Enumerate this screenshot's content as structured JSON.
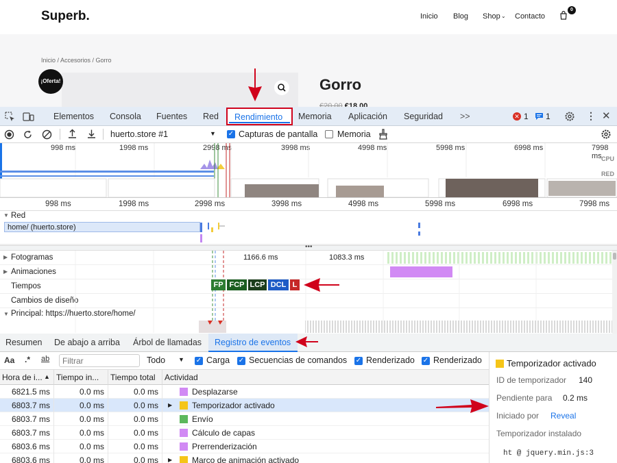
{
  "site": {
    "logo": "Superb.",
    "nav": [
      "Inicio",
      "Blog",
      "Shop",
      "Contacto"
    ],
    "cart_count": "0",
    "breadcrumb": "Inicio / Accesorios / Gorro",
    "sale_badge": "¡Oferta!",
    "product_title": "Gorro",
    "price_old": "€20.00",
    "price_new": "€18.00"
  },
  "devtools": {
    "tabs": [
      "Elementos",
      "Consola",
      "Fuentes",
      "Red",
      "Rendimiento",
      "Memoria",
      "Aplicación",
      "Seguridad"
    ],
    "active_tab": "Rendimiento",
    "more_tabs": ">>",
    "errors": "1",
    "messages": "1",
    "profile_select": "huerto.store #1",
    "chk_screenshots": "Capturas de pantalla",
    "chk_memory": "Memoria",
    "overview_labels": [
      "998 ms",
      "1998 ms",
      "2998 ms",
      "3998 ms",
      "4998 ms",
      "5998 ms",
      "6998 ms",
      "7998 ms"
    ],
    "overview_cpu": "CPU",
    "overview_net": "RED",
    "ruler_labels": [
      "998 ms",
      "1998 ms",
      "2998 ms",
      "3998 ms",
      "4998 ms",
      "5998 ms",
      "6998 ms",
      "7998 ms"
    ],
    "network_title": "Red",
    "network_request": "home/ (huerto.store)",
    "tracks": [
      "Fotogramas",
      "Animaciones",
      "Tiempos",
      "Cambios de diseño",
      "Principal: https://huerto.store/home/"
    ],
    "frame_times": [
      "1166.6 ms",
      "1083.3 ms"
    ],
    "timing_marks": [
      "FP",
      "FCP",
      "LCP",
      "DCL",
      "L"
    ],
    "bottom_tabs": [
      "Resumen",
      "De abajo a arriba",
      "Árbol de llamadas",
      "Registro de eventos"
    ],
    "active_bottom_tab": "Registro de eventos",
    "filter_placeholder": "Filtrar",
    "filter_select": "Todo",
    "filter_checks": [
      "Carga",
      "Secuencias de comandos",
      "Renderizado",
      "Renderizado"
    ],
    "columns": [
      "Hora de i...",
      "Tiempo in...",
      "Tiempo total",
      "Actividad"
    ],
    "rows": [
      {
        "start": "6821.5 ms",
        "self": "0.0 ms",
        "total": "0.0 ms",
        "activity": "Desplazarse",
        "color": "#d18af4",
        "expand": ""
      },
      {
        "start": "6803.7 ms",
        "self": "0.0 ms",
        "total": "0.0 ms",
        "activity": "Temporizador activado",
        "color": "#f5c518",
        "expand": "▶"
      },
      {
        "start": "6803.7 ms",
        "self": "0.0 ms",
        "total": "0.0 ms",
        "activity": "Envío",
        "color": "#5cb85c",
        "expand": ""
      },
      {
        "start": "6803.7 ms",
        "self": "0.0 ms",
        "total": "0.0 ms",
        "activity": "Cálculo de capas",
        "color": "#d18af4",
        "expand": ""
      },
      {
        "start": "6803.6 ms",
        "self": "0.0 ms",
        "total": "0.0 ms",
        "activity": "Prerrenderización",
        "color": "#d18af4",
        "expand": ""
      },
      {
        "start": "6803.6 ms",
        "self": "0.0 ms",
        "total": "0.0 ms",
        "activity": "Marco de animación activado",
        "color": "#f5c518",
        "expand": "▶"
      }
    ],
    "details": {
      "title": "Temporizador activado",
      "timer_id_label": "ID de temporizador",
      "timer_id": "140",
      "pending_label": "Pendiente para",
      "pending": "0.2 ms",
      "initiator_label": "Iniciado por",
      "initiator": "Reveal",
      "installed_label": "Temporizador instalado",
      "stack": "ht @ jquery.min.js:3"
    }
  },
  "colors": {
    "accent": "#1a73e8",
    "arrow": "#d0021b",
    "fp": "#2e7d32",
    "fcp": "#1b5e20",
    "lcp": "#1b3d1b",
    "dcl": "#1e5bc6",
    "load": "#c62828"
  }
}
